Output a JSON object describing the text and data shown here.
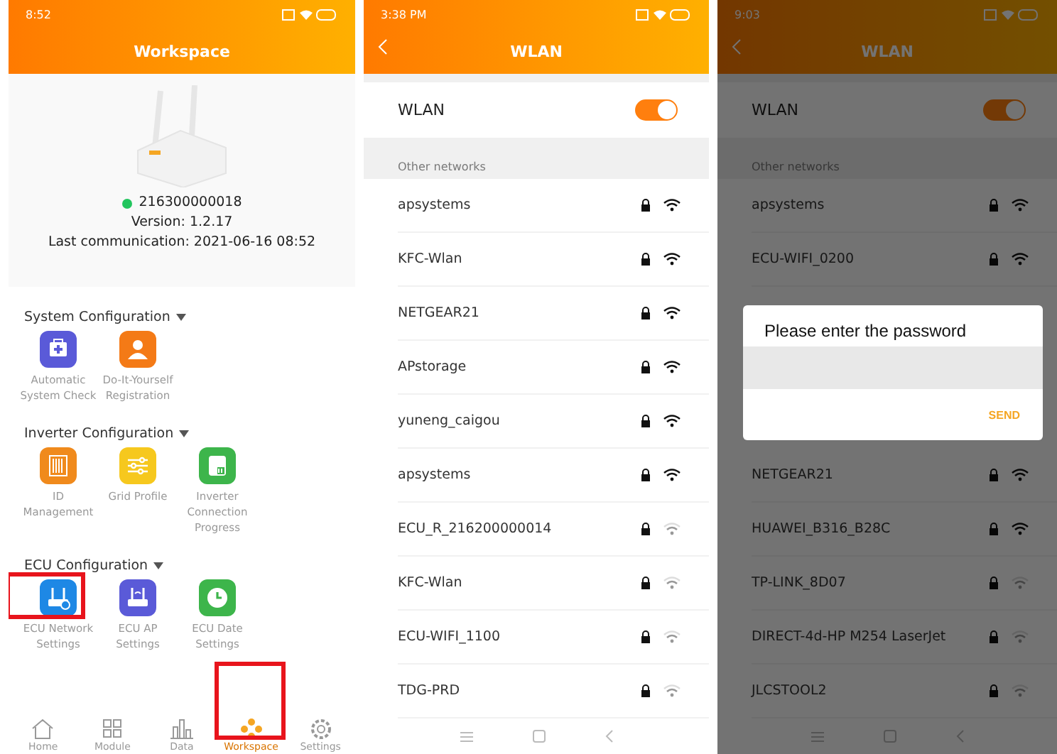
{
  "workspace_screen": {
    "status_bar": {
      "time": "8:52"
    },
    "title": "Workspace",
    "device": {
      "online": true,
      "serial": "216300000018",
      "version": "Version: 1.2.17",
      "last_communication": "Last communication: 2021-06-16 08:52"
    },
    "sections": [
      {
        "title": "System Configuration",
        "expanded": true,
        "items": [
          {
            "kind": "kit",
            "label": "Automatic System Check",
            "color": "#5a5ad8",
            "highlighted": false
          },
          {
            "kind": "person",
            "label": "Do-It-Yourself Registration",
            "color": "#f47a16",
            "highlighted": false
          }
        ]
      },
      {
        "title": "Inverter Configuration",
        "expanded": true,
        "items": [
          {
            "kind": "barcode",
            "label": "ID Management",
            "color": "#f08a1c",
            "highlighted": false
          },
          {
            "kind": "sliders",
            "label": "Grid Profile",
            "color": "#f6c81e",
            "highlighted": false
          },
          {
            "kind": "inverter",
            "label": "Inverter Connection Progress",
            "color": "#3db54b",
            "highlighted": false
          }
        ]
      },
      {
        "title": "ECU Configuration",
        "expanded": true,
        "items": [
          {
            "kind": "router",
            "label": "ECU Network Settings",
            "color": "#1e88e5",
            "highlighted": true
          },
          {
            "kind": "router-wifi",
            "label": "ECU AP Settings",
            "color": "#5a5ad8",
            "highlighted": false
          },
          {
            "kind": "clock",
            "label": "ECU Date Settings",
            "color": "#3db54b",
            "highlighted": false
          }
        ]
      }
    ],
    "nav": [
      {
        "kind": "home",
        "label": "Home",
        "selected": false,
        "highlighted": false
      },
      {
        "kind": "grid",
        "label": "Module",
        "selected": false,
        "highlighted": false
      },
      {
        "kind": "chart",
        "label": "Data",
        "selected": false,
        "highlighted": false
      },
      {
        "kind": "logo",
        "label": "Workspace",
        "selected": true,
        "highlighted": true
      },
      {
        "kind": "gear",
        "label": "Settings",
        "selected": false,
        "highlighted": false
      }
    ]
  },
  "wlan_screen": {
    "status_bar": {
      "time": "3:38 PM"
    },
    "title": "WLAN",
    "wlan": {
      "label": "WLAN",
      "on": true
    },
    "group_label": "Other networks",
    "networks": [
      {
        "name": "apsystems",
        "locked": true,
        "weak": false
      },
      {
        "name": "KFC-Wlan",
        "locked": true,
        "weak": false
      },
      {
        "name": "NETGEAR21",
        "locked": true,
        "weak": false
      },
      {
        "name": "APstorage",
        "locked": true,
        "weak": false
      },
      {
        "name": "yuneng_caigou",
        "locked": true,
        "weak": false
      },
      {
        "name": "apsystems",
        "locked": true,
        "weak": false
      },
      {
        "name": "ECU_R_216200000014",
        "locked": true,
        "weak": true
      },
      {
        "name": "KFC-Wlan",
        "locked": true,
        "weak": true
      },
      {
        "name": "ECU-WIFI_1100",
        "locked": true,
        "weak": true
      },
      {
        "name": "TDG-PRD",
        "locked": true,
        "weak": true
      }
    ]
  },
  "password_screen": {
    "status_bar": {
      "time": "9:03"
    },
    "title": "WLAN",
    "dimmed": true,
    "wlan": {
      "label": "WLAN",
      "on": true
    },
    "group_label": "Other networks",
    "networks": [
      {
        "name": "apsystems",
        "locked": true,
        "weak": false
      },
      {
        "name": "ECU-WIFI_0200",
        "locked": true,
        "weak": false
      }
    ],
    "dialog": {
      "title": "Please enter the password",
      "button": "SEND"
    },
    "networks_below": [
      {
        "name": "NETGEAR21",
        "locked": true,
        "weak": false
      },
      {
        "name": "HUAWEI_B316_B28C",
        "locked": true,
        "weak": false
      },
      {
        "name": "TP-LINK_8D07",
        "locked": true,
        "weak": true
      },
      {
        "name": "DIRECT-4d-HP M254 LaserJet",
        "locked": true,
        "weak": true
      },
      {
        "name": "JLCSTOOL2",
        "locked": true,
        "weak": true
      }
    ]
  }
}
